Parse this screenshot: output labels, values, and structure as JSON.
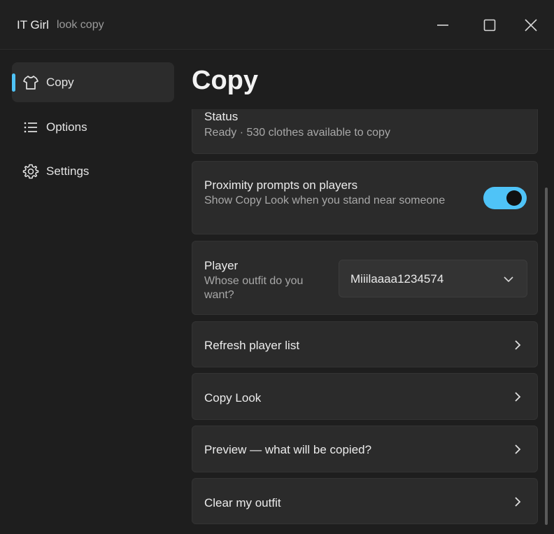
{
  "window": {
    "title": "IT Girl",
    "subtitle": "look copy"
  },
  "sidebar": {
    "items": [
      {
        "label": "Copy",
        "icon": "shirt-icon",
        "active": true
      },
      {
        "label": "Options",
        "icon": "list-icon",
        "active": false
      },
      {
        "label": "Settings",
        "icon": "gear-icon",
        "active": false
      }
    ]
  },
  "page": {
    "title": "Copy"
  },
  "cards": {
    "status": {
      "title": "Status",
      "desc": "Ready · 530 clothes available to copy"
    },
    "proximity": {
      "title": "Proximity prompts on players",
      "desc": "Show Copy Look when you stand near someone",
      "enabled": true
    },
    "player": {
      "title": "Player",
      "desc": "Whose outfit do you want?",
      "selected": "Miiilaaaa1234574"
    },
    "refresh": {
      "title": "Refresh player list"
    },
    "copy_look": {
      "title": "Copy Look"
    },
    "preview": {
      "title": "Preview — what will be copied?"
    },
    "clear": {
      "title": "Clear my outfit"
    }
  },
  "colors": {
    "accent": "#4fc3f7",
    "background": "#1e1e1e",
    "card": "#2b2b2b"
  }
}
